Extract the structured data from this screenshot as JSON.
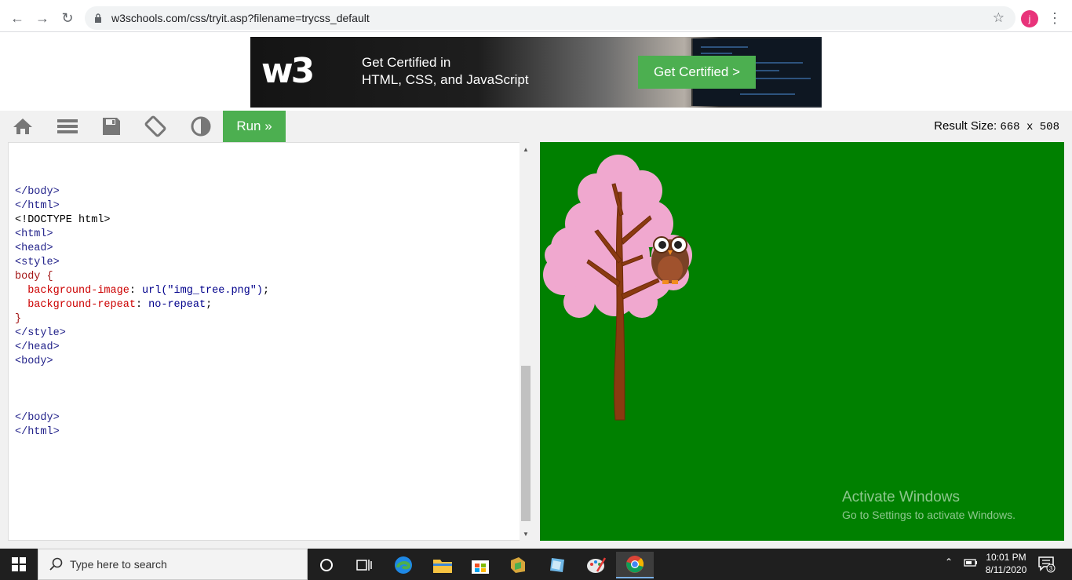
{
  "browser": {
    "url": "w3schools.com/css/tryit.asp?filename=trycss_default",
    "profile_initial": "j"
  },
  "ad": {
    "logo": "w3",
    "line1": "Get Certified in",
    "line2": "HTML, CSS, and JavaScript",
    "cta": "Get Certified >"
  },
  "toolbar": {
    "run_label": "Run »",
    "result_size_label": "Result Size:",
    "result_size_value": "668 x 508",
    "icons": [
      "home-icon",
      "menu-icon",
      "save-icon",
      "rotate-icon",
      "contrast-icon"
    ]
  },
  "editor": {
    "lines": [
      {
        "parts": [
          {
            "t": "</body>",
            "c": "tag-b"
          }
        ]
      },
      {
        "parts": [
          {
            "t": "</html>",
            "c": "tag-b"
          }
        ]
      },
      {
        "parts": [
          {
            "t": "<!DOCTYPE html>",
            "c": "plain"
          }
        ]
      },
      {
        "parts": [
          {
            "t": "<html>",
            "c": "tag-b"
          }
        ]
      },
      {
        "parts": [
          {
            "t": "<head>",
            "c": "tag-b"
          }
        ]
      },
      {
        "parts": [
          {
            "t": "<style>",
            "c": "tag-b"
          }
        ]
      },
      {
        "parts": [
          {
            "t": "body {",
            "c": "tag"
          }
        ]
      },
      {
        "parts": [
          {
            "t": "  ",
            "c": "plain"
          },
          {
            "t": "background-image",
            "c": "prop"
          },
          {
            "t": ": ",
            "c": "plain"
          },
          {
            "t": "url(\"img_tree.png\")",
            "c": "val"
          },
          {
            "t": ";",
            "c": "plain"
          }
        ]
      },
      {
        "parts": [
          {
            "t": "  ",
            "c": "plain"
          },
          {
            "t": "background-repeat",
            "c": "prop"
          },
          {
            "t": ": ",
            "c": "plain"
          },
          {
            "t": "no-repeat",
            "c": "val"
          },
          {
            "t": ";",
            "c": "plain"
          }
        ]
      },
      {
        "parts": [
          {
            "t": "}",
            "c": "tag"
          }
        ]
      },
      {
        "parts": [
          {
            "t": "</style>",
            "c": "tag-b"
          }
        ]
      },
      {
        "parts": [
          {
            "t": "</head>",
            "c": "tag-b"
          }
        ]
      },
      {
        "parts": [
          {
            "t": "<body>",
            "c": "tag-b"
          }
        ]
      },
      {
        "parts": [
          {
            "t": "",
            "c": "plain"
          }
        ]
      },
      {
        "parts": [
          {
            "t": "",
            "c": "plain"
          }
        ]
      },
      {
        "parts": [
          {
            "t": "",
            "c": "plain"
          }
        ]
      },
      {
        "parts": [
          {
            "t": "</body>",
            "c": "tag-b"
          }
        ]
      },
      {
        "parts": [
          {
            "t": "</html>",
            "c": "tag-b"
          }
        ]
      }
    ]
  },
  "result": {
    "background": "#008000",
    "watermark_title": "Activate Windows",
    "watermark_sub": "Go to Settings to activate Windows."
  },
  "taskbar": {
    "search_placeholder": "Type here to search",
    "time": "10:01 PM",
    "date": "8/11/2020",
    "notification_count": "3",
    "apps": [
      "cortana-icon",
      "task-view-icon",
      "edge-icon",
      "file-explorer-icon",
      "store-icon",
      "app-icon",
      "app-icon-2",
      "paint-icon",
      "chrome-icon"
    ]
  },
  "colors": {
    "accent_green": "#4caf50",
    "code_tag": "#22228a",
    "code_prop": "#cc0000",
    "code_value": "#00008b"
  }
}
